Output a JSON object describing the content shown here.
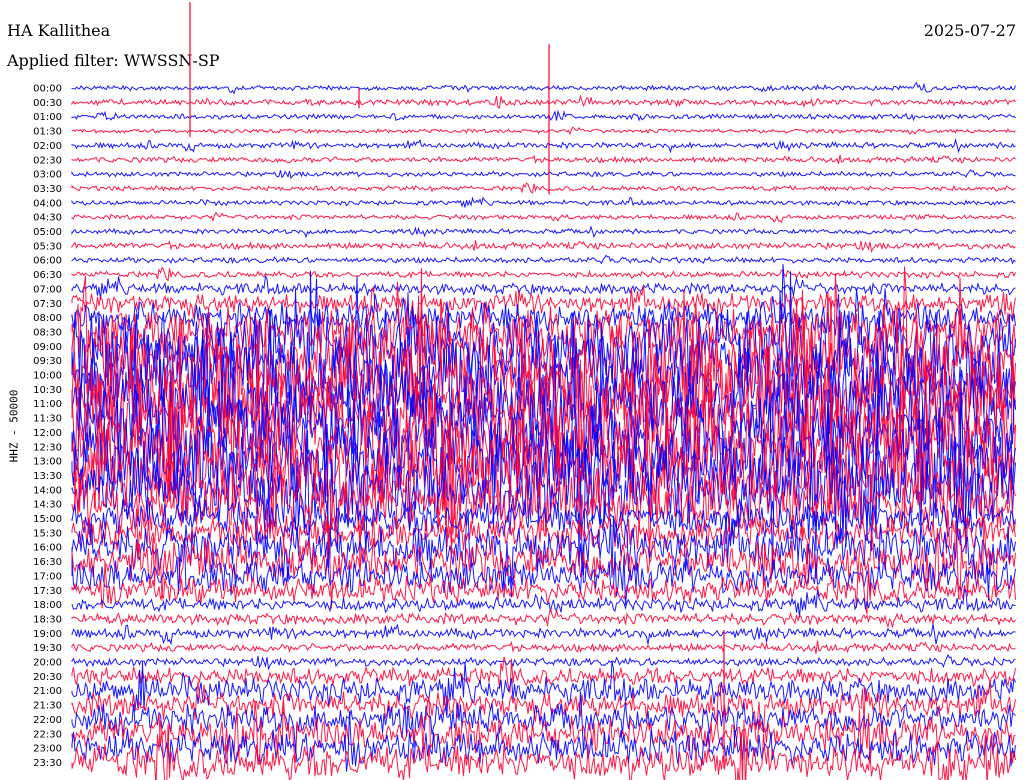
{
  "header": {
    "station": "HA Kallithea",
    "date": "2025-07-27",
    "filter_label": "Applied filter: WWSSN-SP"
  },
  "chart_data": {
    "type": "seismogram-helicorder",
    "title": "HA Kallithea",
    "date": "2025-07-27",
    "filter": "WWSSN-SP",
    "ylabel": "HHZ - 50000",
    "line_interval_minutes": 30,
    "colors": [
      "#0000ff",
      "#ff0033"
    ],
    "rows": [
      {
        "time": "00:00",
        "activity": 0.04
      },
      {
        "time": "00:30",
        "activity": 0.05
      },
      {
        "time": "01:00",
        "activity": 0.04
      },
      {
        "time": "01:30",
        "activity": 0.03
      },
      {
        "time": "02:00",
        "activity": 0.05
      },
      {
        "time": "02:30",
        "activity": 0.05
      },
      {
        "time": "03:00",
        "activity": 0.04
      },
      {
        "time": "03:30",
        "activity": 0.04
      },
      {
        "time": "04:00",
        "activity": 0.04
      },
      {
        "time": "04:30",
        "activity": 0.04
      },
      {
        "time": "05:00",
        "activity": 0.04
      },
      {
        "time": "05:30",
        "activity": 0.06
      },
      {
        "time": "06:00",
        "activity": 0.05
      },
      {
        "time": "06:30",
        "activity": 0.06
      },
      {
        "time": "07:00",
        "activity": 0.12
      },
      {
        "time": "07:30",
        "activity": 0.22
      },
      {
        "time": "08:00",
        "activity": 0.35
      },
      {
        "time": "08:30",
        "activity": 0.6
      },
      {
        "time": "09:00",
        "activity": 0.9
      },
      {
        "time": "09:30",
        "activity": 1.0
      },
      {
        "time": "10:00",
        "activity": 1.0
      },
      {
        "time": "10:30",
        "activity": 1.0
      },
      {
        "time": "11:00",
        "activity": 1.0
      },
      {
        "time": "11:30",
        "activity": 1.0
      },
      {
        "time": "12:00",
        "activity": 1.0
      },
      {
        "time": "12:30",
        "activity": 1.0
      },
      {
        "time": "13:00",
        "activity": 1.0
      },
      {
        "time": "13:30",
        "activity": 0.95
      },
      {
        "time": "14:00",
        "activity": 0.9
      },
      {
        "time": "14:30",
        "activity": 0.75
      },
      {
        "time": "15:00",
        "activity": 0.45
      },
      {
        "time": "15:30",
        "activity": 0.4
      },
      {
        "time": "16:00",
        "activity": 0.55
      },
      {
        "time": "16:30",
        "activity": 0.5
      },
      {
        "time": "17:00",
        "activity": 0.4
      },
      {
        "time": "17:30",
        "activity": 0.3
      },
      {
        "time": "18:00",
        "activity": 0.15
      },
      {
        "time": "18:30",
        "activity": 0.12
      },
      {
        "time": "19:00",
        "activity": 0.1
      },
      {
        "time": "19:30",
        "activity": 0.08
      },
      {
        "time": "20:00",
        "activity": 0.08
      },
      {
        "time": "20:30",
        "activity": 0.2
      },
      {
        "time": "21:00",
        "activity": 0.3
      },
      {
        "time": "21:30",
        "activity": 0.3
      },
      {
        "time": "22:00",
        "activity": 0.35
      },
      {
        "time": "22:30",
        "activity": 0.4
      },
      {
        "time": "23:00",
        "activity": 0.4
      },
      {
        "time": "23:30",
        "activity": 0.45
      }
    ]
  }
}
